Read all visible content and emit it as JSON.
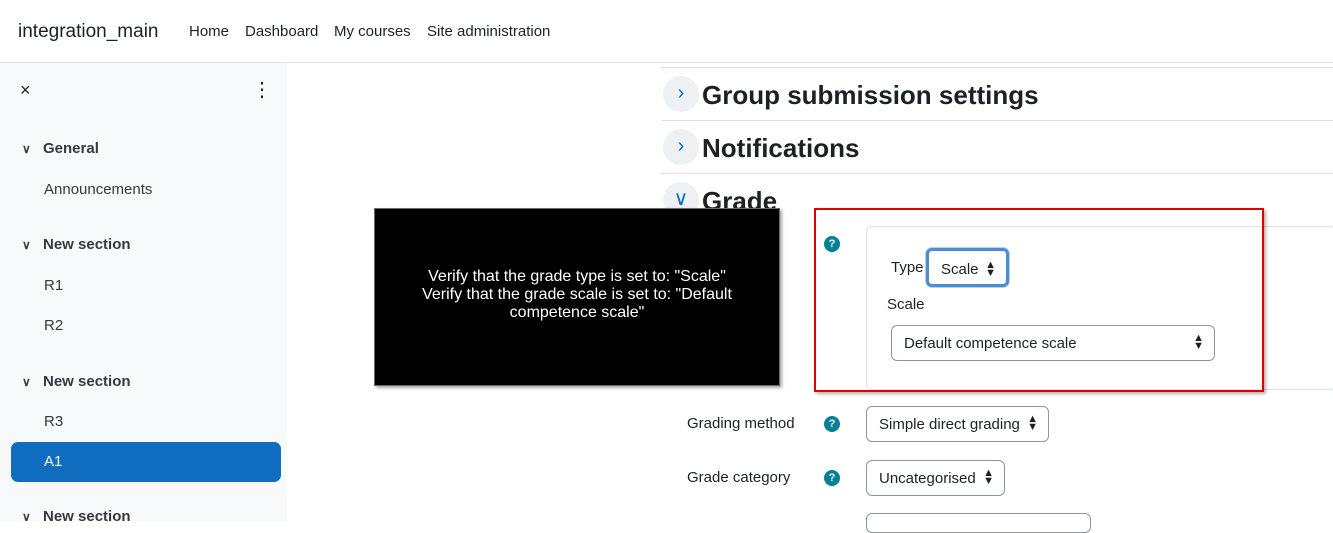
{
  "navbar": {
    "brand": "integration_main",
    "items": [
      "Home",
      "Dashboard",
      "My courses",
      "Site administration"
    ]
  },
  "drawer": {
    "close_icon": "×",
    "menu_icon": "⋮",
    "sections": [
      {
        "title": "General",
        "items": [
          "Announcements"
        ]
      },
      {
        "title": "New section",
        "items": [
          "R1",
          "R2"
        ]
      },
      {
        "title": "New section",
        "items": [
          "R3",
          "A1"
        ]
      },
      {
        "title": "New section",
        "items": []
      }
    ],
    "active_item": "A1"
  },
  "main": {
    "sections": [
      {
        "title": "Group submission settings",
        "expanded": false
      },
      {
        "title": "Notifications",
        "expanded": false
      },
      {
        "title": "Grade",
        "expanded": true
      }
    ],
    "grade": {
      "type_label": "Type",
      "type_value": "Scale",
      "scale_label": "Scale",
      "scale_value": "Default competence scale",
      "grading_method_label": "Grading method",
      "grading_method_value": "Simple direct grading",
      "grade_category_label": "Grade category",
      "grade_category_value": "Uncategorised"
    },
    "help_icon": "?"
  },
  "overlay": {
    "line1": "Verify that the grade type is set to: \"Scale\"",
    "line2": "Verify that the grade scale is set to: \"Default competence scale\""
  },
  "colors": {
    "accent": "#0f6cbf",
    "help": "#008196",
    "highlight": "#e00000",
    "drawer_bg": "#f8f9fa"
  },
  "icons": {
    "collapsed": "chevron-right-icon",
    "expanded": "chevron-down-icon",
    "close": "close-icon",
    "menu": "kebab-menu-icon",
    "help": "question-circle-icon"
  }
}
